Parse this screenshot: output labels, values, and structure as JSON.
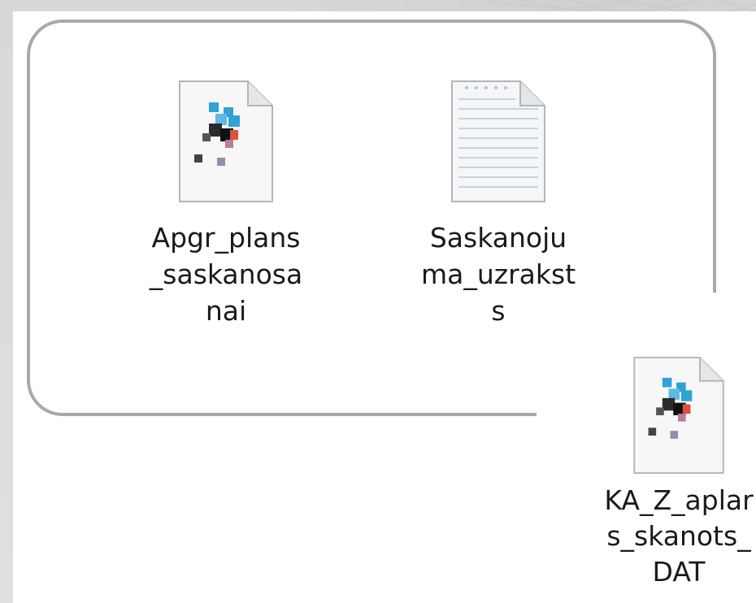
{
  "files": [
    {
      "name": "Apgr_plans_saskanosanai",
      "label_lines": [
        "Apgr_plans",
        "_saskanosa",
        "nai"
      ],
      "icon": "image-file-icon"
    },
    {
      "name": "Saskanojuma_uzraksts",
      "label_lines": [
        "Saskanoju",
        "ma_uzrakst",
        "s"
      ],
      "icon": "text-file-icon"
    },
    {
      "name": "KA_Z_aplans_skanots_DAT",
      "label_lines": [
        "KA_Z_aplar",
        "s_skanots_",
        "DAT"
      ],
      "icon": "image-file-icon"
    }
  ],
  "colors": {
    "frame": "#a9a9a9",
    "icon_blue": "#2fa3d6",
    "icon_dark": "#2b2b2b",
    "icon_red": "#d9533a"
  }
}
